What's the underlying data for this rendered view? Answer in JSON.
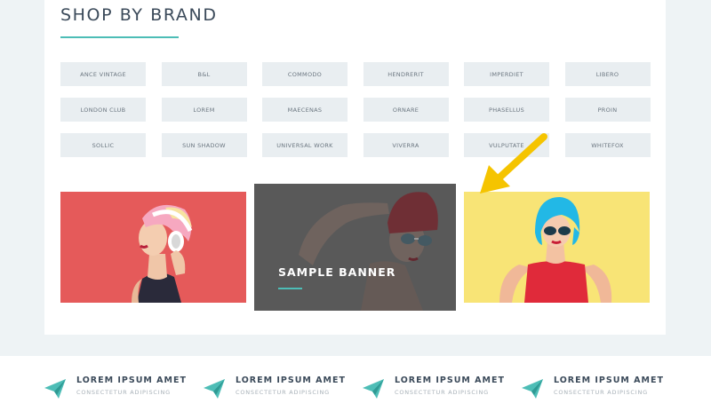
{
  "section": {
    "title": "SHOP BY BRAND"
  },
  "brands": [
    "ANCE VINTAGE",
    "B&L",
    "COMMODO",
    "HENDRERIT",
    "IMPERDIET",
    "LIBERO",
    "LONDON CLUB",
    "LOREM",
    "MAECENAS",
    "ORNARE",
    "PHASELLUS",
    "PROIN",
    "SOLLIC",
    "SUN SHADOW",
    "UNIVERSAL WORK",
    "VIVERRA",
    "VULPUTATE",
    "WHITEFOX"
  ],
  "banners": {
    "center_label": "SAMPLE BANNER",
    "left_bg": "#e55a5a",
    "right_bg": "#f8e476"
  },
  "features": [
    {
      "title": "LOREM IPSUM AMET",
      "subtitle": "CONSECTETUR ADIPISCING",
      "icon": "paper-plane-icon"
    },
    {
      "title": "LOREM IPSUM AMET",
      "subtitle": "CONSECTETUR ADIPISCING",
      "icon": "paper-plane-icon"
    },
    {
      "title": "LOREM IPSUM AMET",
      "subtitle": "CONSECTETUR ADIPISCING",
      "icon": "paper-plane-icon"
    },
    {
      "title": "LOREM IPSUM AMET",
      "subtitle": "CONSECTETUR ADIPISCING",
      "icon": "paper-plane-icon"
    }
  ],
  "colors": {
    "accent": "#4dbdb6",
    "arrow": "#f5c400",
    "text_dark": "#3b4a5a"
  }
}
